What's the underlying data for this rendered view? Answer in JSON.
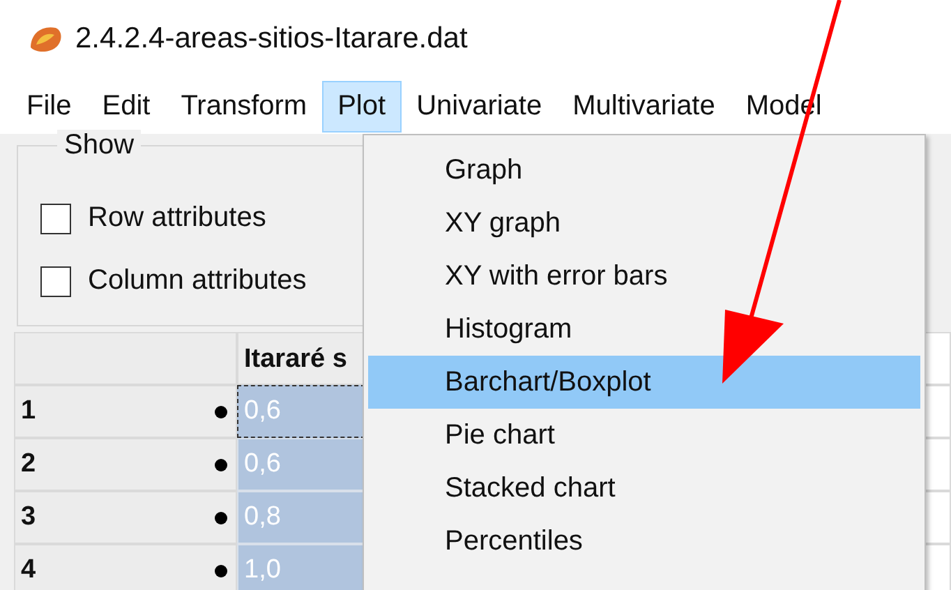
{
  "window": {
    "title": "2.4.2.4-areas-sitios-Itarare.dat"
  },
  "menubar": [
    {
      "label": "File",
      "selected": false
    },
    {
      "label": "Edit",
      "selected": false
    },
    {
      "label": "Transform",
      "selected": false
    },
    {
      "label": "Plot",
      "selected": true
    },
    {
      "label": "Univariate",
      "selected": false
    },
    {
      "label": "Multivariate",
      "selected": false
    },
    {
      "label": "Model",
      "selected": false
    }
  ],
  "show_group": {
    "title": "Show",
    "options": [
      {
        "label": "Row attributes",
        "checked": false
      },
      {
        "label": "Column attributes",
        "checked": false
      }
    ]
  },
  "table": {
    "columns": [
      "Itararé s"
    ],
    "rows": [
      {
        "label": "1",
        "value": "0,6",
        "focused": true
      },
      {
        "label": "2",
        "value": "0,6",
        "focused": false
      },
      {
        "label": "3",
        "value": "0,8",
        "focused": false
      },
      {
        "label": "4",
        "value": "1,0",
        "focused": false
      }
    ]
  },
  "plot_menu": [
    {
      "label": "Graph",
      "selected": false
    },
    {
      "label": "XY graph",
      "selected": false
    },
    {
      "label": "XY with error bars",
      "selected": false
    },
    {
      "label": "Histogram",
      "selected": false
    },
    {
      "label": "Barchart/Boxplot",
      "selected": true
    },
    {
      "label": "Pie chart",
      "selected": false
    },
    {
      "label": "Stacked chart",
      "selected": false
    },
    {
      "label": "Percentiles",
      "selected": false
    }
  ]
}
